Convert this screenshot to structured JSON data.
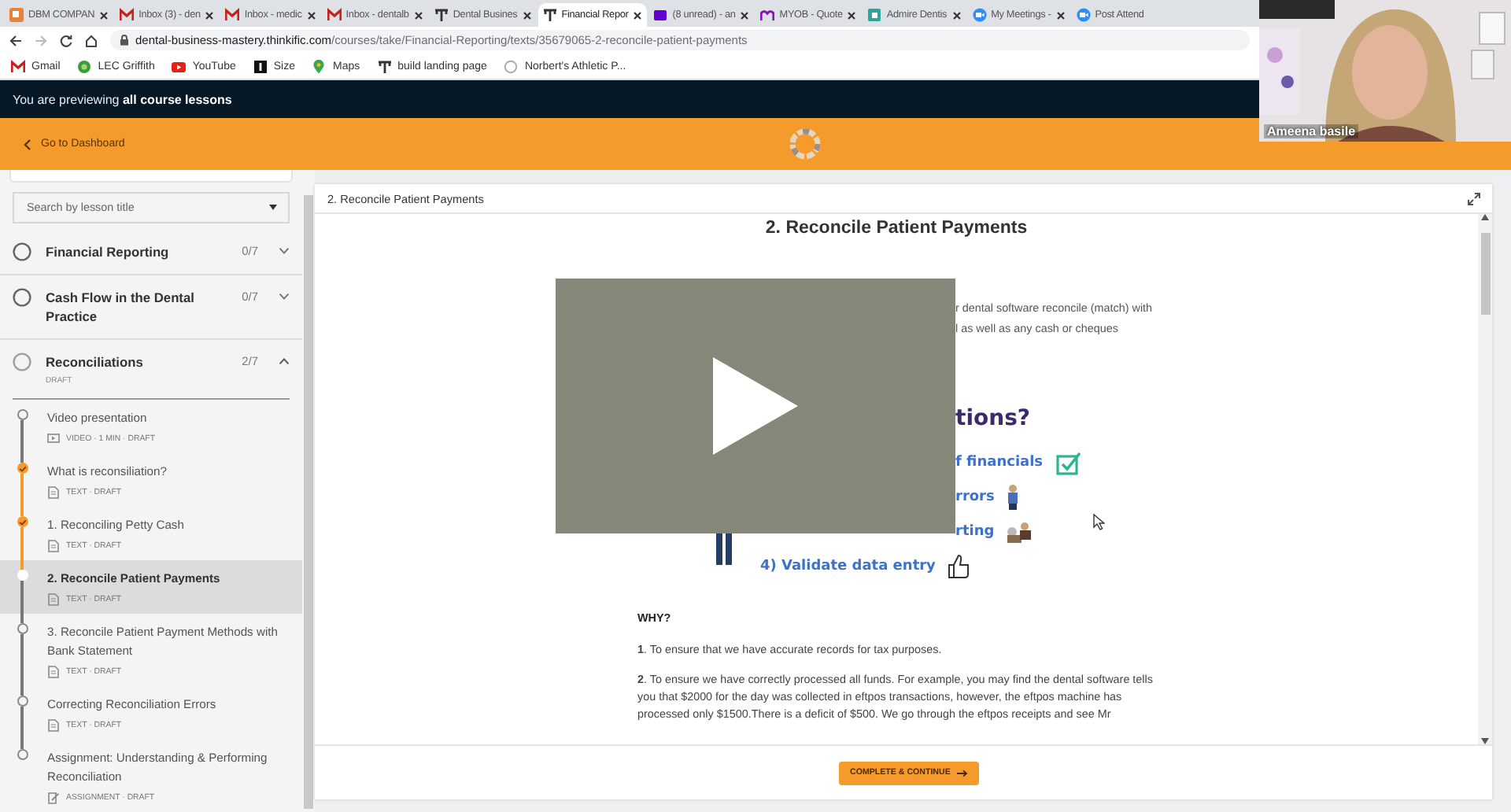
{
  "browser": {
    "tabs": [
      {
        "label": "DBM COMPAN",
        "kind": "dbm",
        "selected": false
      },
      {
        "label": "Inbox (3) - den",
        "kind": "gmail",
        "selected": false
      },
      {
        "label": "Inbox - medic",
        "kind": "gmail",
        "selected": false
      },
      {
        "label": "Inbox - dentalb",
        "kind": "gmail",
        "selected": false
      },
      {
        "label": "Dental Busines",
        "kind": "thinkific",
        "selected": false
      },
      {
        "label": "Financial Repor",
        "kind": "thinkific",
        "selected": true
      },
      {
        "label": "(8 unread) - an",
        "kind": "yahoo",
        "selected": false
      },
      {
        "label": "MYOB - Quote",
        "kind": "myob",
        "selected": false
      },
      {
        "label": "Admire Dentis",
        "kind": "admire",
        "selected": false
      },
      {
        "label": "My Meetings -",
        "kind": "zoom",
        "selected": false
      },
      {
        "label": "Post Attend",
        "kind": "zoom",
        "selected": false
      }
    ],
    "address": {
      "domain": "dental-business-mastery.thinkific.com",
      "path": "/courses/take/Financial-Reporting/texts/35679065-2-reconcile-patient-payments"
    },
    "bookmarks": [
      {
        "label": "Gmail",
        "kind": "gmail"
      },
      {
        "label": "LEC Griffith",
        "kind": "globe"
      },
      {
        "label": "YouTube",
        "kind": "youtube"
      },
      {
        "label": "Size",
        "kind": "block"
      },
      {
        "label": "Maps",
        "kind": "maps"
      },
      {
        "label": "build landing page",
        "kind": "thinkific"
      },
      {
        "label": "Norbert's Athletic P...",
        "kind": "blank"
      }
    ]
  },
  "preview_banner": "You are previewing **all course lessons**",
  "header": {
    "back_link": "Go to Dashboard"
  },
  "sidebar": {
    "search": {
      "placeholder": "Search by lesson title"
    },
    "chapters": [
      {
        "title": "Financial Reporting",
        "progress": "0/7",
        "expanded": false
      },
      {
        "title": "Cash Flow in the Dental Practice",
        "progress": "0/7",
        "expanded": false
      },
      {
        "title": "Reconciliations",
        "progress": "2/7",
        "expanded": true,
        "status": "DRAFT",
        "lessons": [
          {
            "title": "Video presentation",
            "kind": "video",
            "meta": "VIDEO · 1 MIN · DRAFT",
            "completed": false,
            "selected": false
          },
          {
            "title": "What is reconsiliation?",
            "kind": "text",
            "meta": "TEXT · DRAFT",
            "completed": true,
            "selected": false
          },
          {
            "title": "1. Reconciling Petty Cash",
            "kind": "text",
            "meta": "TEXT · DRAFT",
            "completed": true,
            "selected": false
          },
          {
            "title": "2. Reconcile Patient Payments",
            "kind": "text",
            "meta": "TEXT · DRAFT",
            "completed": false,
            "selected": true
          },
          {
            "title": "3. Reconcile Patient Payment Methods with Bank Statement",
            "kind": "text",
            "meta": "TEXT · DRAFT",
            "completed": false,
            "selected": false
          },
          {
            "title": "Correcting Reconciliation Errors",
            "kind": "text",
            "meta": "TEXT · DRAFT",
            "completed": false,
            "selected": false
          },
          {
            "title": "Assignment: Understanding & Performing Reconciliation",
            "kind": "assignment",
            "meta": "ASSIGNMENT · DRAFT",
            "completed": false,
            "selected": false
          }
        ]
      }
    ]
  },
  "lesson": {
    "header_title": "2. Reconcile Patient Payments",
    "title": "2. Reconcile Patient Payments",
    "intro_fragments": [
      "r dental software reconcile (match) with",
      "l as well as any cash or cheques"
    ],
    "infographic": {
      "heading": "tions?",
      "points": [
        {
          "text": "f financials",
          "kind": "check",
          "partly_hidden": true
        },
        {
          "text": "rrors",
          "kind": "person",
          "partly_hidden": true
        },
        {
          "text": "rting",
          "kind": "people",
          "partly_hidden": true
        },
        {
          "text": "4) Validate data entry",
          "kind": "thumb",
          "partly_hidden": false
        }
      ]
    },
    "why_heading": "WHY?",
    "paragraphs": [
      "**1**. To ensure that we have accurate records for tax purposes.",
      "**2**. To ensure we have correctly processed all funds. For example, you may find the dental software tells you that $2000 for the day was collected in eftpos transactions, however, the eftpos machine has processed only $1500.There is a deficit of $500. We go through the eftpos receipts and see Mr"
    ]
  },
  "footer": {
    "button": "COMPLETE & CONTINUE"
  },
  "webcam": {
    "name": "Ameena basile"
  }
}
